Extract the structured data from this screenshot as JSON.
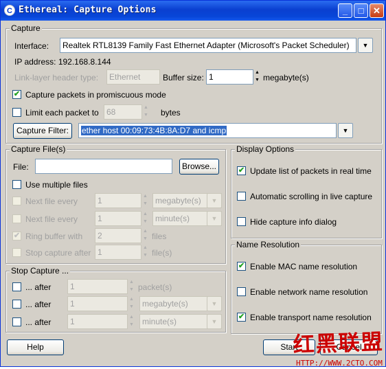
{
  "window": {
    "title": "Ethereal: Capture Options",
    "icon": "C",
    "min": "_",
    "max": "□",
    "close": "✕"
  },
  "capture": {
    "group": "Capture",
    "interface_label": "Interface:",
    "interface_value": "Realtek RTL8139 Family Fast Ethernet Adapter (Microsoft's Packet Scheduler)",
    "ip": "IP address: 192.168.8.144",
    "linklayer_label": "Link-layer header type:",
    "linklayer_value": "Ethernet",
    "buffer_label": "Buffer size:",
    "buffer_value": "1",
    "buffer_unit": "megabyte(s)",
    "promisc_label": "Capture packets in promiscuous mode",
    "limit_label": "Limit each packet to",
    "limit_value": "68",
    "limit_unit": "bytes",
    "filter_button": "Capture Filter:",
    "filter_value": "ether host 00:09:73:4B:8A:D7 and icmp"
  },
  "files": {
    "group": "Capture File(s)",
    "file_label": "File:",
    "file_value": "",
    "browse": "Browse...",
    "multiple": "Use multiple files",
    "rows": [
      {
        "label": "Next file every",
        "value": "1",
        "unit": "megabyte(s)"
      },
      {
        "label": "Next file every",
        "value": "1",
        "unit": "minute(s)"
      },
      {
        "label": "Ring buffer with",
        "value": "2",
        "unit": "files"
      },
      {
        "label": "Stop capture after",
        "value": "1",
        "unit": "file(s)"
      }
    ]
  },
  "stop": {
    "group": "Stop Capture ...",
    "rows": [
      {
        "label": "... after",
        "value": "1",
        "unit": "packet(s)"
      },
      {
        "label": "... after",
        "value": "1",
        "unit": "megabyte(s)"
      },
      {
        "label": "... after",
        "value": "1",
        "unit": "minute(s)"
      }
    ]
  },
  "display": {
    "group": "Display Options",
    "update": "Update list of packets in real time",
    "autoscroll": "Automatic scrolling in live capture",
    "hide": "Hide capture info dialog"
  },
  "names": {
    "group": "Name Resolution",
    "mac": "Enable MAC name resolution",
    "network": "Enable network name resolution",
    "transport": "Enable transport name resolution"
  },
  "buttons": {
    "help": "Help",
    "start": "Start",
    "cancel": "Cancel"
  },
  "watermark": {
    "text": "红黑联盟",
    "url": "HTTP://WWW.2CTO.COM"
  },
  "colors": {
    "titlebar": "#0a3fd0",
    "dialog": "#d4d0c8",
    "selection": "#316ac5",
    "checkmark": "#21a121"
  }
}
